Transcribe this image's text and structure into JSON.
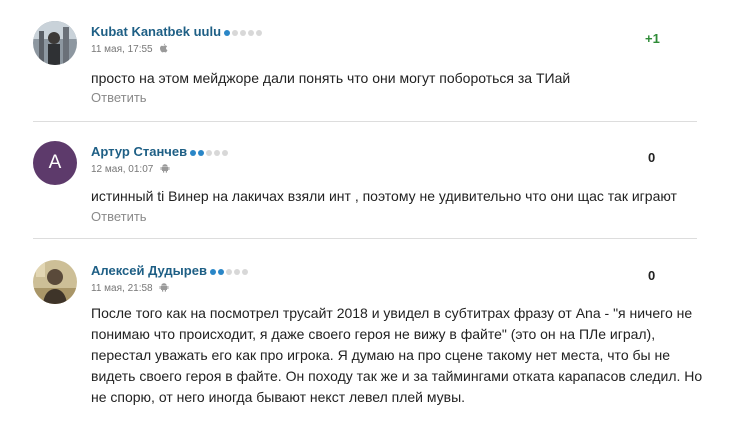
{
  "comments": [
    {
      "author": "Kubat Kanatbek uulu",
      "rank_on": 1,
      "date": "11 мая, 17:55",
      "device": "apple-icon",
      "score": "+1",
      "text": "просто на этом мейджоре дали понять что они могут побороться за ТИай",
      "reply": "Ответить"
    },
    {
      "author": "Артур Станчев",
      "avatar_letter": "А",
      "rank_on": 2,
      "date": "12 мая, 01:07",
      "device": "android-icon",
      "score": "0",
      "text": "истинный ti Винер на лакичах взяли инт , поэтому не удивительно что они щас так играют",
      "reply": "Ответить"
    },
    {
      "author": "Алексей Дудырев",
      "rank_on": 2,
      "date": "11 мая, 21:58",
      "device": "android-icon",
      "score": "0",
      "text": "После того как на посмотрел трусайт 2018 и увидел в субтитрах фразу от Ana - \"я ничего не понимаю что происходит, я даже своего героя не вижу в файте\" (это он на ПЛе играл), перестал уважать его как про игрока. Я думаю на про сцене такому нет места, что бы не видеть своего героя в файте. Он походу так же и за таймингами отката карапасов следил. Но не спорю, от него иногда бывают некст левел плей мувы.",
      "reply": "Ответить"
    }
  ],
  "colors": {
    "author": "#1e5f85",
    "rank_active": "#2a86c7",
    "score_positive": "#2e8b36",
    "avatar_letter_bg": "#5d3a6b"
  }
}
